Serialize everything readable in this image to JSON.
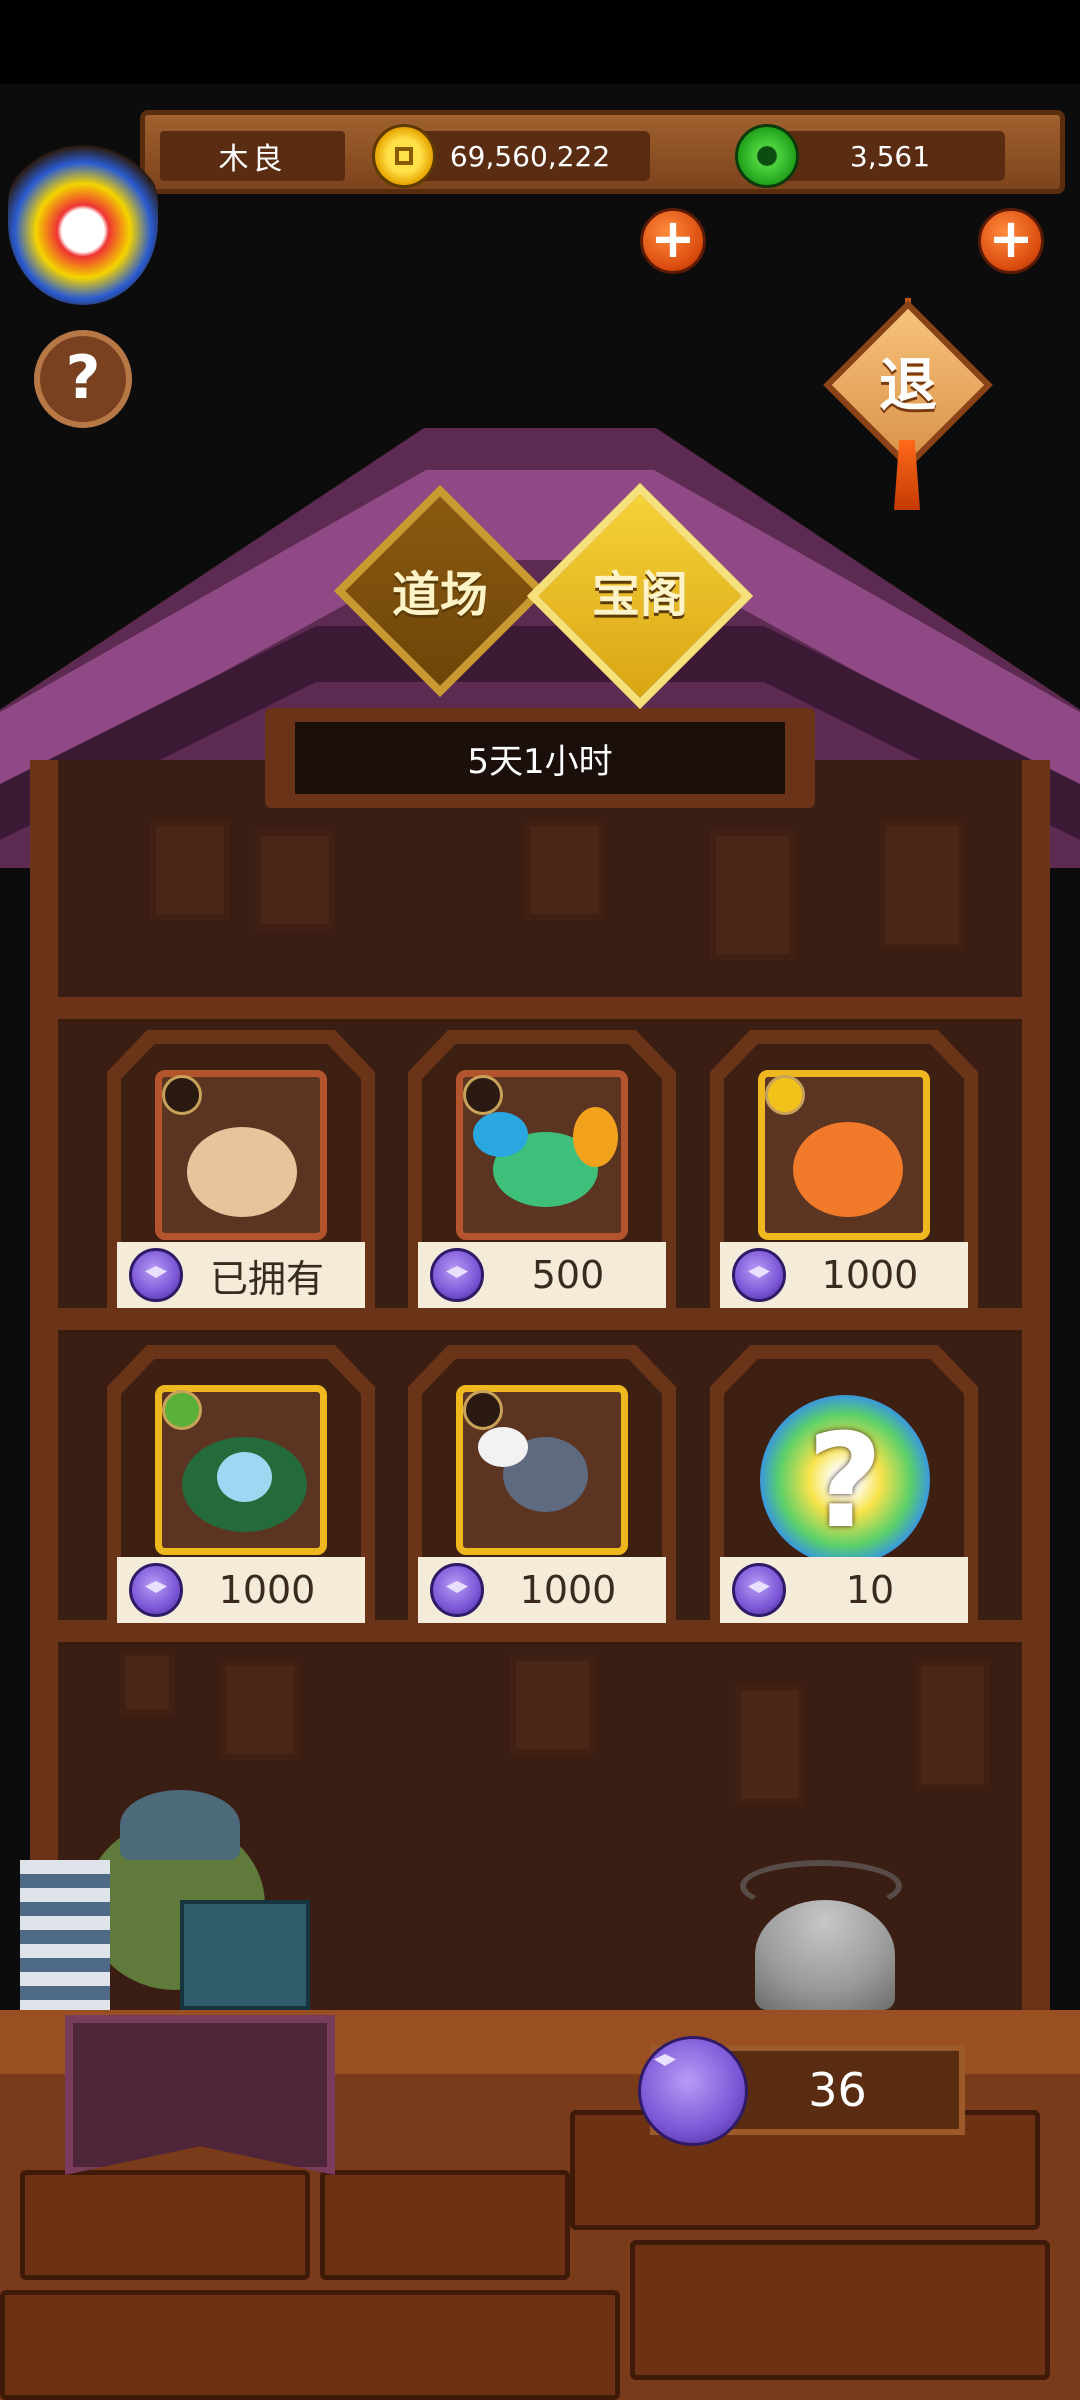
{
  "player": {
    "name": "木良"
  },
  "currency": {
    "coins": "69,560,222",
    "jade": "3,561"
  },
  "buttons": {
    "help": "?",
    "exit": "退"
  },
  "tabs": [
    {
      "label": "道场"
    },
    {
      "label": "宝阁"
    }
  ],
  "timer": "5天1小时",
  "items": [
    {
      "price": "已拥有",
      "element_icon": "earth-icon",
      "creature": "mouse-creature"
    },
    {
      "price": "500",
      "element_icon": "moon-icon",
      "creature": "winged-fish-creature"
    },
    {
      "price": "1000",
      "element_icon": "sun-icon",
      "creature": "fox-creature"
    },
    {
      "price": "1000",
      "element_icon": "leaf-icon",
      "creature": "deer-spirit-creature"
    },
    {
      "price": "1000",
      "element_icon": "earth-icon",
      "creature": "dragon-creature"
    },
    {
      "price": "10",
      "element_icon": "",
      "creature": "mystery-orb"
    }
  ],
  "footer": {
    "gem_count": "36"
  },
  "colors": {
    "wood": "#6b3418",
    "roof": "#8f4a85",
    "gold": "#f0b81f",
    "gem": "#7b56d6",
    "plus": "#d94a0d"
  }
}
